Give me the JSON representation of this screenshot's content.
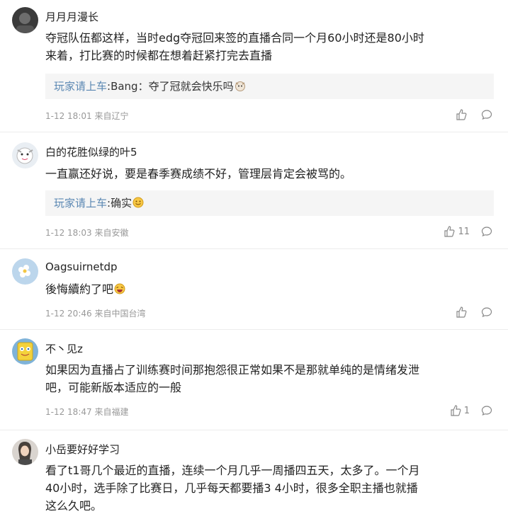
{
  "comments": [
    {
      "username": "月月月漫长",
      "avatar": "dark-avatar",
      "lines": [
        "夺冠队伍都这样，当时edg夺冠回来签的直播合同一个月60小时还是80小时",
        "来着，打比赛的时候都在想着赶紧打完去直播"
      ],
      "reply": {
        "name": "玩家请上车",
        "text": ":Bang：夺了冠就会快乐吗"
      },
      "meta": "1-12 18:01 来自辽宁",
      "likes": ""
    },
    {
      "username": "白的花胜似绿的叶5",
      "avatar": "cartoon-avatar",
      "lines": [
        "一直赢还好说，要是春季赛成绩不好，管理层肯定会被骂的。"
      ],
      "reply": {
        "name": "玩家请上车",
        "text": ":确实"
      },
      "meta": "1-12 18:03 来自安徽",
      "likes": "11"
    },
    {
      "username": "Oagsuirnetdp",
      "avatar": "flower-avatar",
      "lines": [
        "後悔續約了吧"
      ],
      "meta": "1-12 20:46 来自中国台湾",
      "likes": ""
    },
    {
      "username": "不丶见z",
      "avatar": "sponge-avatar",
      "lines": [
        "如果因为直播占了训练赛时间那抱怨很正常如果不是那就单纯的是情绪发泄",
        "吧，可能新版本适应的一般"
      ],
      "meta": "1-12 18:47 来自福建",
      "likes": "1"
    },
    {
      "username": "小岳要好好学习",
      "avatar": "girl-avatar",
      "lines": [
        "看了t1哥几个最近的直播，连续一个月几乎一周播四五天，太多了。一个月",
        "40小时，选手除了比赛日，几乎每天都要播3 4小时，很多全职主播也就播",
        "这么久吧。"
      ],
      "likes": ""
    }
  ],
  "colors": {
    "reply_name": "#5b88b3",
    "meta": "#999999",
    "reply_bg": "#f5f5f5"
  }
}
